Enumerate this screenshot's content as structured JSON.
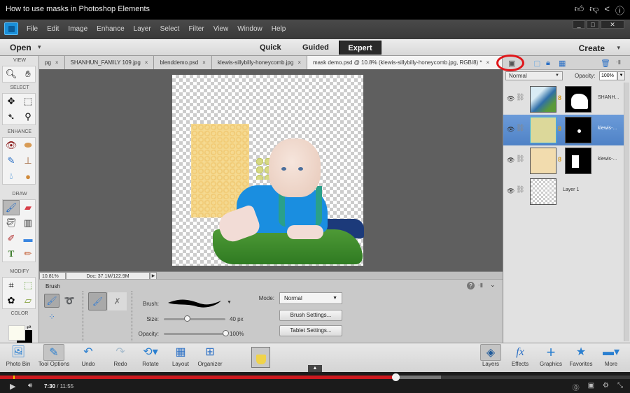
{
  "video": {
    "title": "How to use masks in Photoshop Elements",
    "top_icons": [
      "thumbs-up",
      "thumbs-down",
      "share",
      "info"
    ],
    "current_time": "7:30",
    "duration": "11:55",
    "played_fraction": 0.628,
    "buffered_fraction": 0.7
  },
  "app": {
    "menu": [
      "File",
      "Edit",
      "Image",
      "Enhance",
      "Layer",
      "Select",
      "Filter",
      "View",
      "Window",
      "Help"
    ],
    "window_controls": {
      "minimize": "_",
      "maximize": "□",
      "close": "✕"
    },
    "open_label": "Open",
    "create_label": "Create",
    "modes": {
      "quick": "Quick",
      "guided": "Guided",
      "expert": "Expert"
    },
    "active_mode": "Expert"
  },
  "tabs": [
    {
      "label": "pg",
      "active": false
    },
    {
      "label": "SHANHUN_FAMILY 109.jpg",
      "active": false
    },
    {
      "label": "blenddemo.psd",
      "active": false
    },
    {
      "label": "klewis-sillybilly-honeycomb.jpg",
      "active": false
    },
    {
      "label": "mask demo.psd @ 10.8% (klewis-sillybilly-honeycomb.jpg, RGB/8) *",
      "active": true
    }
  ],
  "tab_close": "×",
  "toolbox": {
    "sections": {
      "view": "VIEW",
      "select": "SELECT",
      "enhance": "ENHANCE",
      "draw": "DRAW",
      "modify": "MODIFY",
      "color": "COLOR"
    },
    "colors": {
      "foreground": "#fbfbef",
      "background": "#000000"
    }
  },
  "status": {
    "zoom": "10.81%",
    "doc": "Doc: 37.1M/122.9M"
  },
  "tool_options": {
    "title": "Brush",
    "brush_label": "Brush:",
    "size_label": "Size:",
    "size_value": "40 px",
    "size_fraction": 0.38,
    "opacity_label": "Opacity:",
    "opacity_value": "100%",
    "opacity_fraction": 1.0,
    "mode_label": "Mode:",
    "mode_value": "Normal",
    "brush_settings": "Brush Settings...",
    "tablet_settings": "Tablet Settings..."
  },
  "layers": {
    "blend_mode": "Normal",
    "opacity_label": "Opacity:",
    "opacity_value": "100%",
    "items": [
      {
        "name": "SHANH...",
        "selected": false,
        "has_mask": true
      },
      {
        "name": "klewis-...",
        "selected": true,
        "has_mask": true
      },
      {
        "name": "klewis-...",
        "selected": false,
        "has_mask": true
      },
      {
        "name": "Layer 1",
        "selected": false,
        "has_mask": false
      }
    ]
  },
  "taskbar": {
    "left": [
      "Photo Bin",
      "Tool Options",
      "Undo",
      "Redo",
      "Rotate",
      "Layout",
      "Organizer"
    ],
    "right": [
      "Layers",
      "Effects",
      "Graphics",
      "Favorites",
      "More"
    ]
  },
  "accent": {
    "selection_blue": "#5a8cd0",
    "youtube_red": "#cc181e",
    "highlight_circle": "#e0161a"
  }
}
